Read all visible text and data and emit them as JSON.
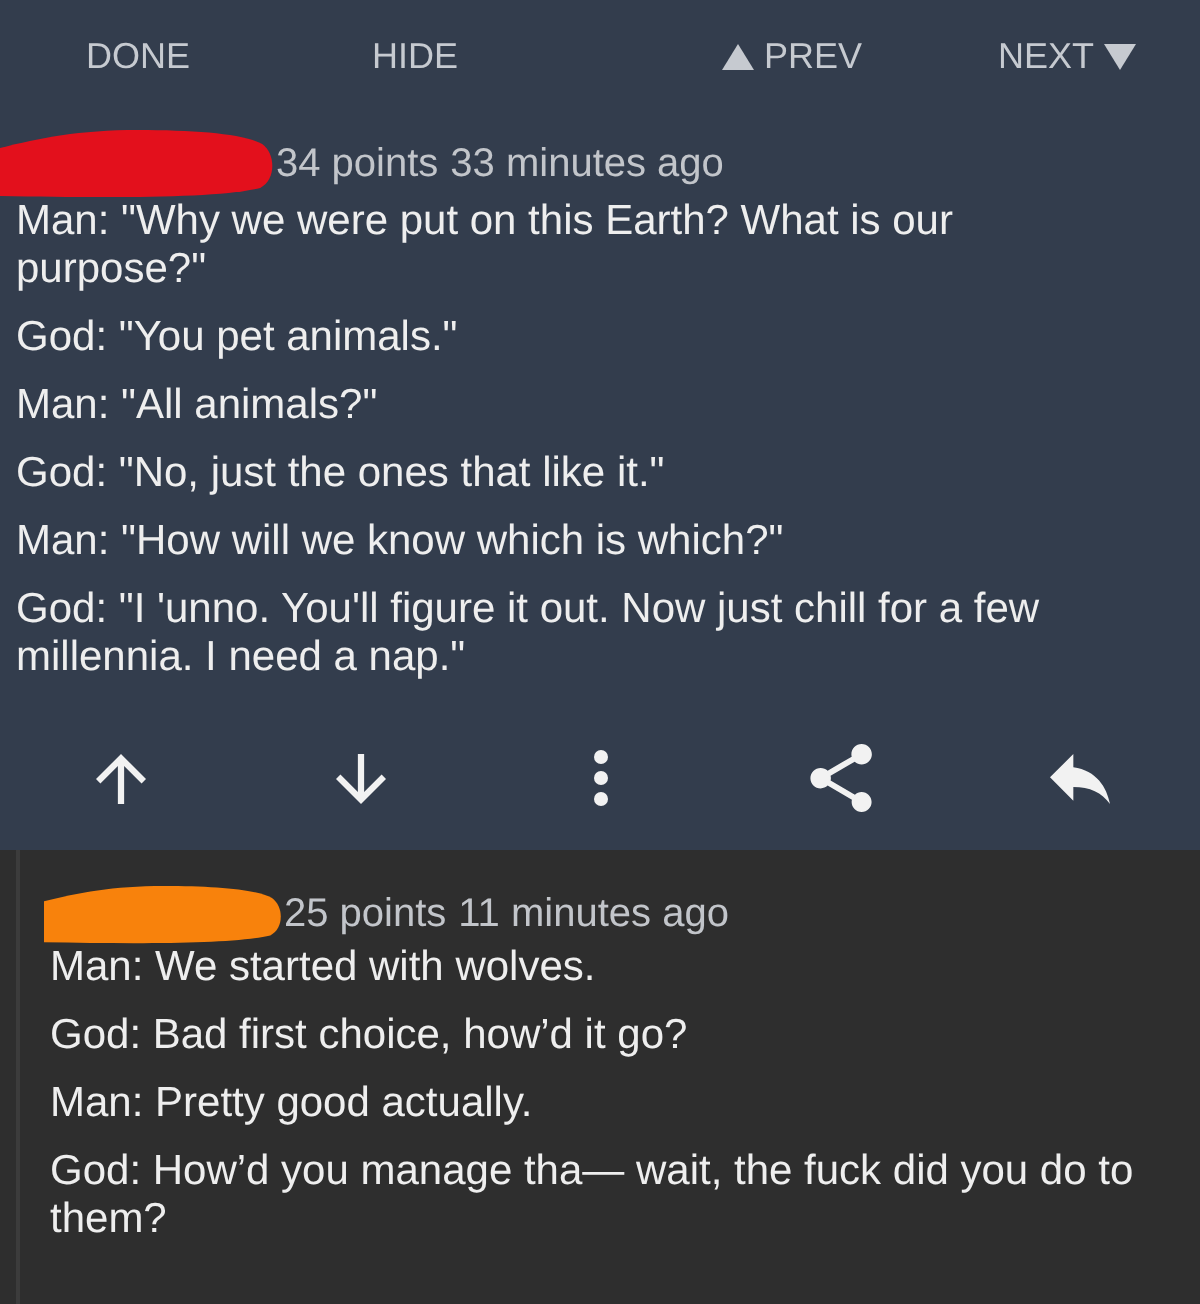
{
  "navigation": [
    {
      "label": "DONE",
      "kind": "text"
    },
    {
      "label": "HIDE",
      "kind": "text"
    },
    {
      "label": "PREV",
      "kind": "previous"
    },
    {
      "label": "NEXT",
      "kind": "next"
    }
  ],
  "comments": [
    {
      "selected": true,
      "redaction": {
        "color": "#e3101c"
      },
      "points": "34 points",
      "time": "33 minutes ago",
      "paragraphs": [
        "Man: \"Why we were put on this Earth? What is our purpose?\"",
        "God: \"You pet animals.\"",
        "Man: \"All animals?\"",
        "God: \"No, just the ones that like it.\"",
        "Man: \"How will we know which is which?\"",
        "God: \"I 'unno. You'll figure it out. Now just chill for a few millennia. I need a nap.\""
      ],
      "children": [
        {
          "selected": false,
          "redaction": {
            "color": "#f8820c"
          },
          "points": "25 points",
          "time": "11 minutes ago",
          "paragraphs": [
            "Man: We started with wolves.",
            "God: Bad first choice, how’d it go?",
            "Man: Pretty good actually.",
            "God: How’d you manage tha— wait, the fuck did you do to them?"
          ]
        }
      ]
    }
  ]
}
